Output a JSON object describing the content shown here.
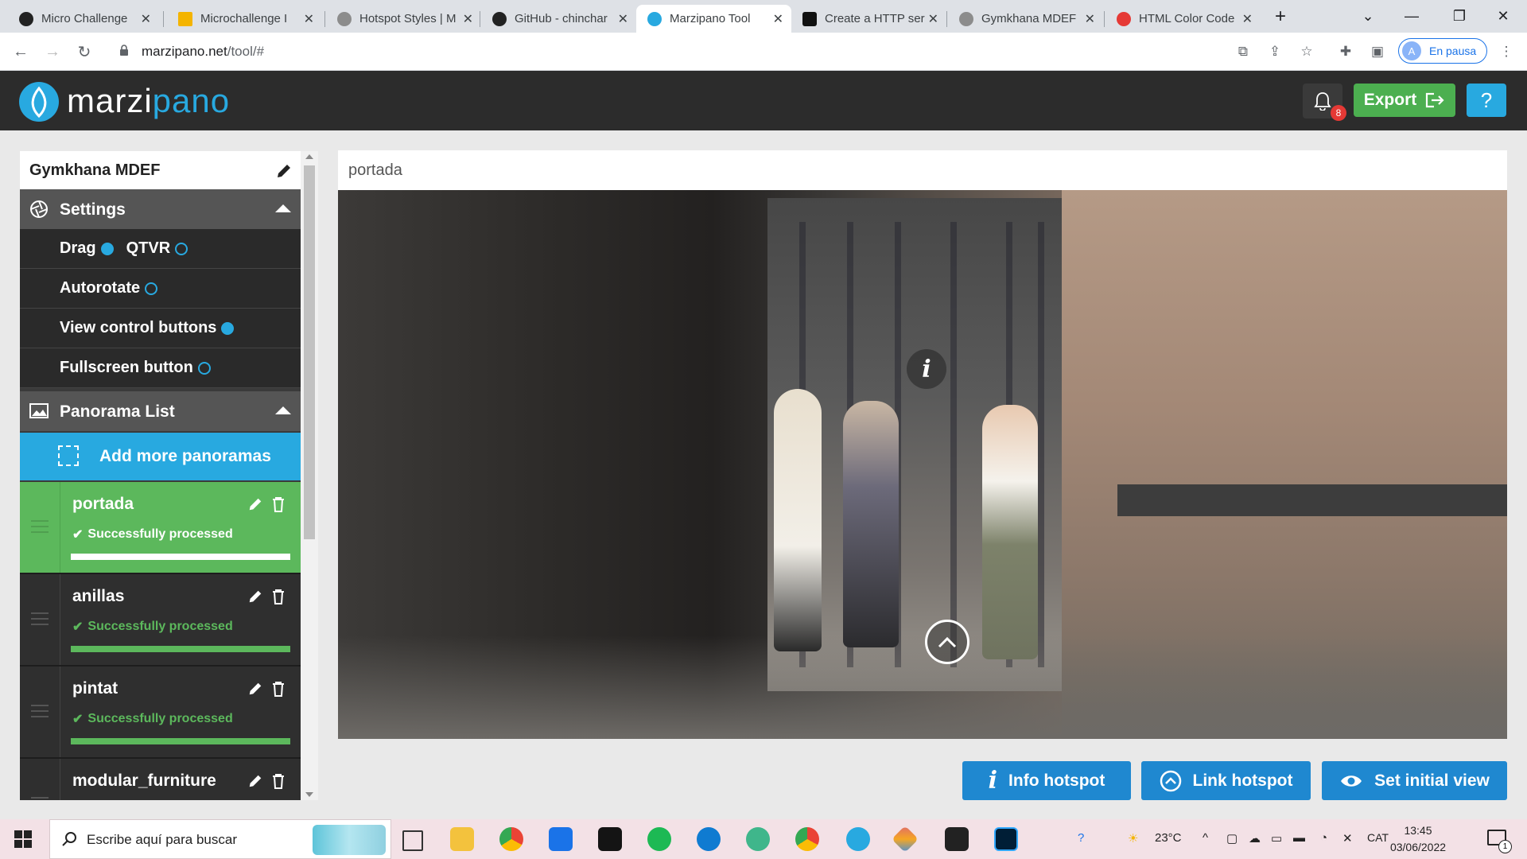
{
  "browser": {
    "tabs": [
      {
        "title": "Micro Challenge",
        "color": "#222222"
      },
      {
        "title": "Microchallenge I",
        "color": "#f4b400"
      },
      {
        "title": "Hotspot Styles | M",
        "color": "#5f6368"
      },
      {
        "title": "GitHub - chinchar",
        "color": "#222222"
      },
      {
        "title": "Marzipano Tool",
        "color": "#28a9e0"
      },
      {
        "title": "Create a HTTP ser",
        "color": "#111111"
      },
      {
        "title": "Gymkhana MDEF",
        "color": "#5f6368"
      },
      {
        "title": "HTML Color Code",
        "color": "#e53935"
      }
    ],
    "active_tab": 4,
    "url_host": "marzipano.net",
    "url_path": "/tool/#",
    "profile_initial": "A",
    "profile_label": "En pausa"
  },
  "header": {
    "logo_part1": "marzi",
    "logo_part2": "pano",
    "notification_count": "8",
    "export_label": "Export",
    "help_label": "?"
  },
  "sidebar": {
    "project_title": "Gymkhana MDEF",
    "settings_label": "Settings",
    "settings": [
      {
        "label": "Drag",
        "on": true,
        "label2": "QTVR",
        "on2": false
      },
      {
        "label": "Autorotate",
        "on": false
      },
      {
        "label": "View control buttons",
        "on": true
      },
      {
        "label": "Fullscreen button",
        "on": false
      }
    ],
    "panorama_list_label": "Panorama List",
    "add_more_label": "Add more panoramas",
    "panoramas": [
      {
        "name": "portada",
        "status": "Successfully processed",
        "active": true
      },
      {
        "name": "anillas",
        "status": "Successfully processed",
        "active": false
      },
      {
        "name": "pintat",
        "status": "Successfully processed",
        "active": false
      },
      {
        "name": "modular_furniture",
        "status": "",
        "active": false
      }
    ]
  },
  "main": {
    "current_panorama": "portada",
    "buttons": {
      "info_hotspot": "Info hotspot",
      "link_hotspot": "Link hotspot",
      "set_initial_view": "Set initial view"
    }
  },
  "taskbar": {
    "search_placeholder": "Escribe aquí para buscar",
    "weather": "23°C",
    "language": "CAT",
    "time": "13:45",
    "date": "03/06/2022",
    "notifications": "1"
  },
  "colors": {
    "accent": "#28a9e0",
    "success": "#5cb85c",
    "export_green": "#4caf50",
    "button_blue": "#1f88d0"
  }
}
